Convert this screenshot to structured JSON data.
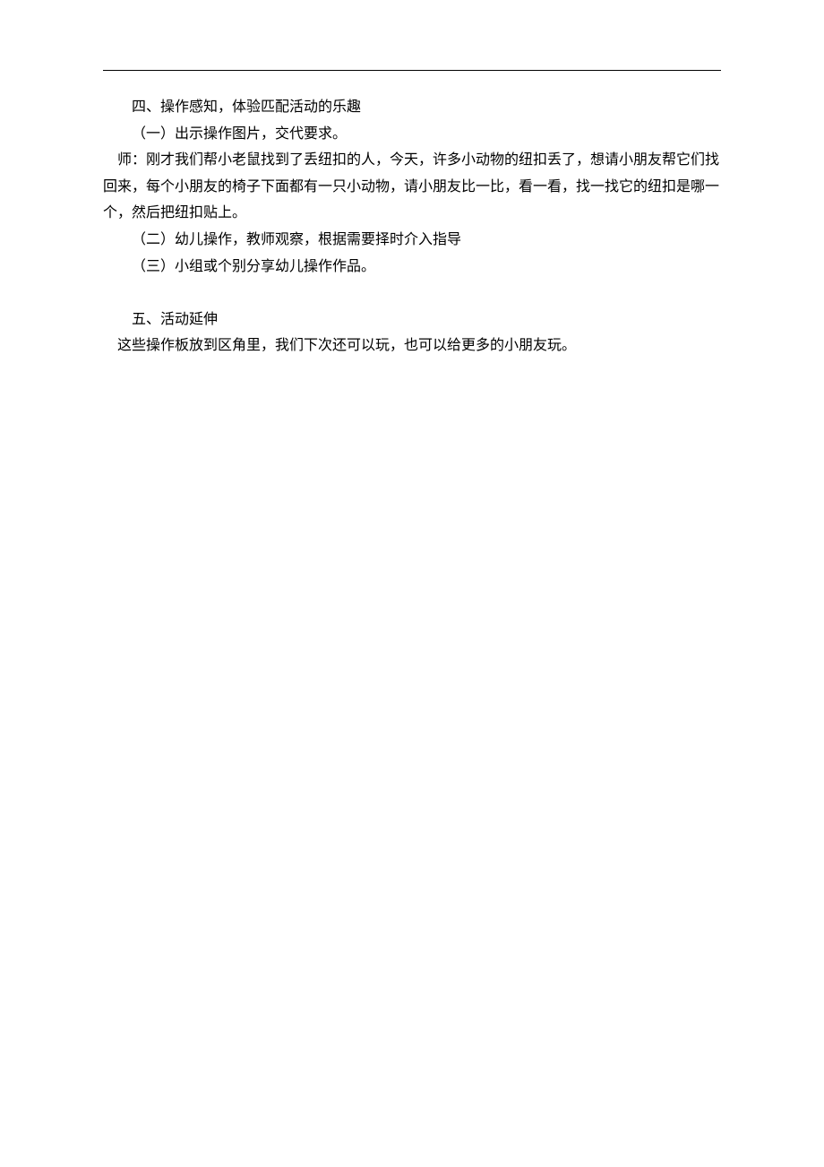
{
  "section4": {
    "heading": "四、操作感知，体验匹配活动的乐趣",
    "sub1": "（一）出示操作图片，交代要求。",
    "teacher_line": "师：刚才我们帮小老鼠找到了丢纽扣的人，今天，许多小动物的纽扣丢了，想请小朋友帮它们找回来，每个小朋友的椅子下面都有一只小动物，请小朋友比一比，看一看，找一找它的纽扣是哪一个，然后把纽扣贴上。",
    "sub2": "（二）幼儿操作，教师观察，根据需要择时介入指导",
    "sub3": "（三）小组或个别分享幼儿操作作品。"
  },
  "section5": {
    "heading": "五、活动延伸",
    "body": "这些操作板放到区角里，我们下次还可以玩，也可以给更多的小朋友玩。"
  }
}
